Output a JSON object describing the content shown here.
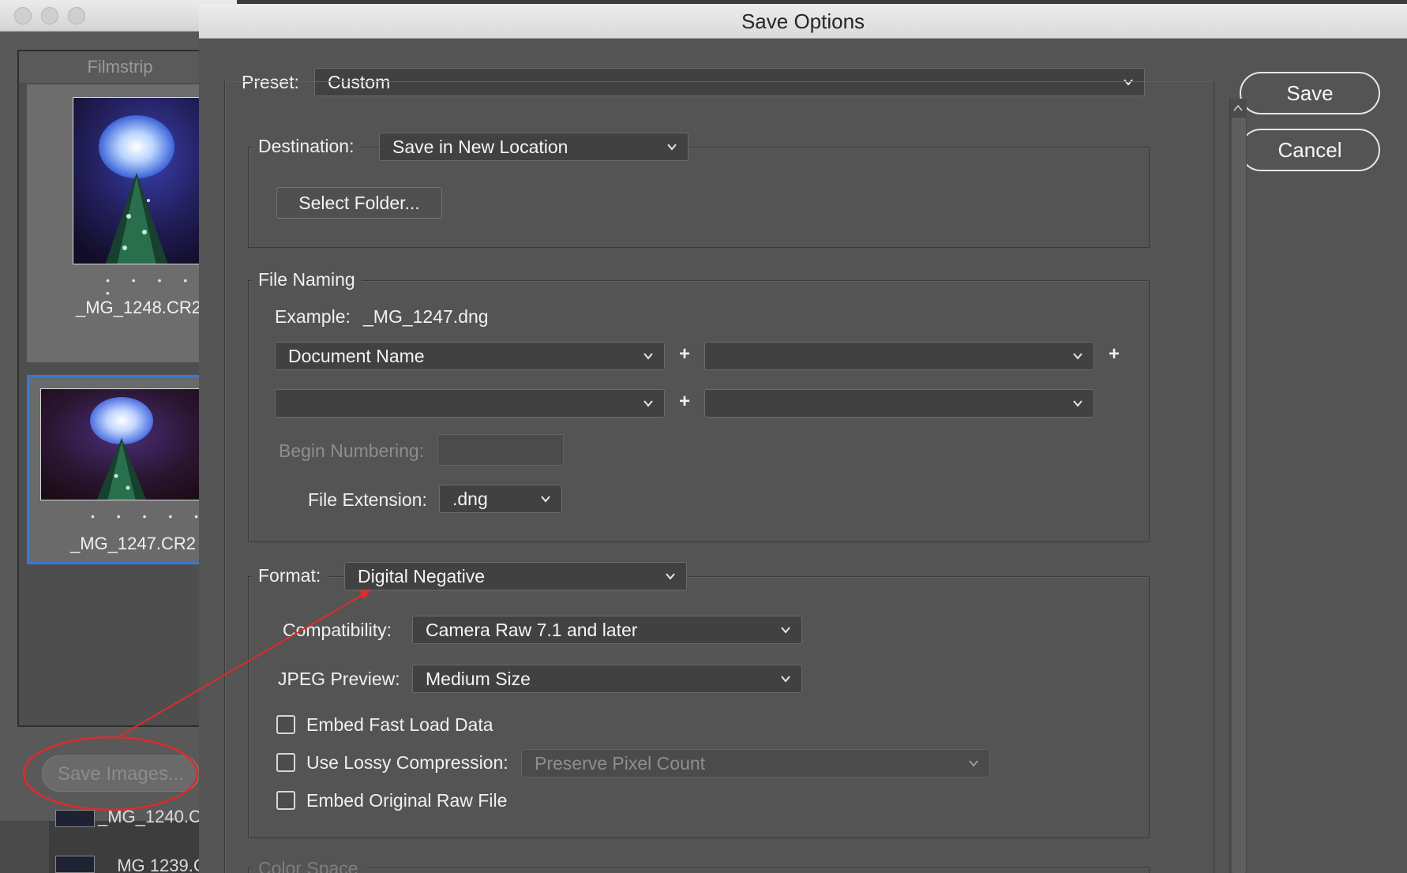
{
  "background_window": {
    "filmstrip_title": "Filmstrip",
    "thumbnails": [
      {
        "name": "_MG_1248.CR2",
        "rating": "• • • • •",
        "selected": false
      },
      {
        "name": "_MG_1247.CR2",
        "rating": "• • • • •",
        "selected": true
      }
    ],
    "partial_items": [
      "_MG_1240.C",
      "_MG 1239.C"
    ],
    "save_images_button": "Save Images..."
  },
  "dialog": {
    "title": "Save Options",
    "preset": {
      "label": "Preset:",
      "value": "Custom"
    },
    "save_button": "Save",
    "cancel_button": "Cancel",
    "destination": {
      "label": "Destination:",
      "value": "Save in New Location",
      "select_folder_button": "Select Folder..."
    },
    "file_naming": {
      "title": "File Naming",
      "example_label": "Example:",
      "example_value": "_MG_1247.dng",
      "fields": [
        "Document Name",
        "",
        "",
        ""
      ],
      "plus": "+",
      "begin_numbering_label": "Begin Numbering:",
      "begin_numbering_value": "",
      "file_extension_label": "File Extension:",
      "file_extension_value": ".dng"
    },
    "format": {
      "label": "Format:",
      "value": "Digital Negative",
      "compatibility_label": "Compatibility:",
      "compatibility_value": "Camera Raw 7.1 and later",
      "jpeg_preview_label": "JPEG Preview:",
      "jpeg_preview_value": "Medium Size",
      "embed_fast_load": {
        "label": "Embed Fast Load Data",
        "checked": false
      },
      "lossy_compression": {
        "label": "Use Lossy Compression:",
        "checked": false,
        "value": "Preserve Pixel Count"
      },
      "embed_original": {
        "label": "Embed Original Raw File",
        "checked": false
      }
    },
    "color_space_title": "Color Space"
  },
  "colors": {
    "dialog_bg": "#545454",
    "annotation_red": "#e02a2a",
    "selection_blue": "#3b79d3"
  }
}
